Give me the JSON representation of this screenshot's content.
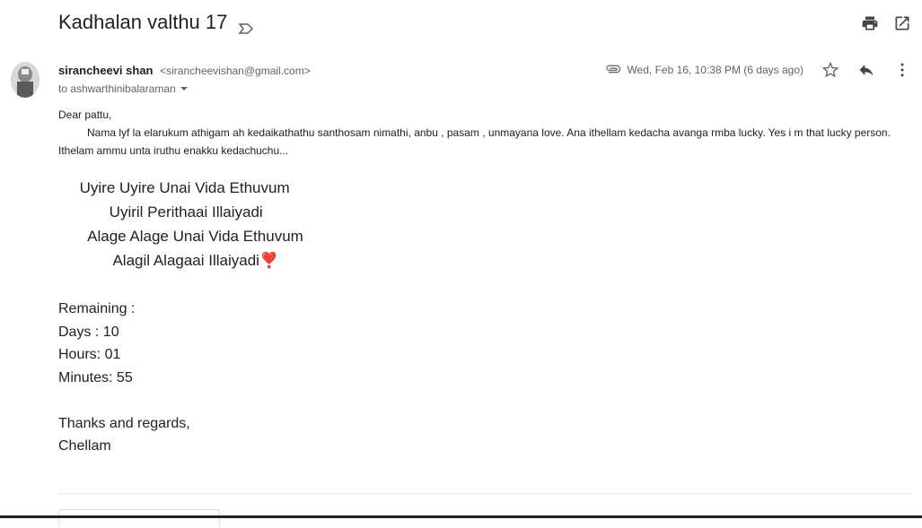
{
  "email": {
    "subject": "Kadhalan valthu 17",
    "sender_name": "sirancheevi shan",
    "sender_email": "<sirancheevishan@gmail.com>",
    "to": "to ashwarthinibalaraman",
    "date": "Wed, Feb 16, 10:38 PM (6 days ago)"
  },
  "body": {
    "greeting": "Dear pattu,",
    "paragraph": "Nama lyf la elarukum athigam ah kedaikathathu santhosam nimathi, anbu , pasam , unmayana love. Ana ithellam  kedacha avanga rmba lucky. Yes i m that lucky person. Ithelam ammu unta iruthu  enakku kedachuchu...",
    "poem": [
      "     Uyire Uyire Unai Vida Ethuvum",
      "            Uyiril Perithaai Illaiyadi",
      "       Alage Alage Unai Vida Ethuvum",
      "             Alagil Alagaai Illaiyadi❣️"
    ],
    "remaining": {
      "title": "Remaining :",
      "days": "Days : 10",
      "hours": "Hours: 01",
      "minutes": "Minutes: 55"
    },
    "signoff": [
      "Thanks and regards,",
      "Chellam"
    ]
  },
  "icons": {
    "label": "label-icon",
    "print": "print-icon",
    "open_new": "open-in-new-icon",
    "attachment": "attachment-icon",
    "star": "star-icon",
    "reply": "reply-icon",
    "more": "more-vert-icon"
  }
}
